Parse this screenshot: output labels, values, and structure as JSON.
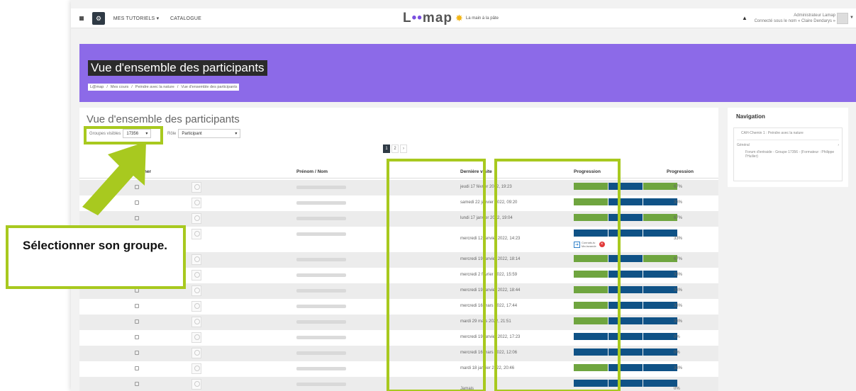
{
  "topbar": {
    "menu1": "MES TUTORIELS ▾",
    "menu2": "CATALOGUE",
    "logo": {
      "pre": "L",
      "accent": "••",
      "post": "map",
      "sub": "La main à la pâte"
    },
    "user_name": "Administrateur Lamap",
    "user_sub": "Connecté sous le nom « Claire Dendarys »"
  },
  "banner": {
    "title": "Vue d'ensemble des participants",
    "breadcrumb": [
      "L@map",
      "Mes cours",
      "Peindre avec la nature",
      "Vue d'ensemble des participants"
    ]
  },
  "main": {
    "title": "Vue d'ensemble des participants",
    "groups_label": "Groupes visibles",
    "groups_value": "17356",
    "role_label": "Rôle",
    "role_value": "Participant",
    "pages": [
      "1",
      "2",
      "›"
    ],
    "columns": {
      "select": "Sélectionner",
      "name": "Prénom / Nom",
      "last_visit": "Dernière visite",
      "progress_bar": "Progression",
      "progress_pct": "Progression"
    },
    "rows": [
      {
        "date": "jeudi 17 février 2022, 19:23",
        "pct": "67%",
        "bar": [
          "g",
          "b",
          "g"
        ]
      },
      {
        "date": "samedi 22 janvier 2022, 09:20",
        "pct": "33%",
        "bar": [
          "g",
          "b",
          "b"
        ]
      },
      {
        "date": "lundi 17 janvier 2022, 19:04",
        "pct": "67%",
        "bar": [
          "g",
          "b",
          "g"
        ]
      },
      {
        "date": "mercredi 12 janvier 2022, 14:23",
        "pct": "33%",
        "bar": [
          "b",
          "b",
          "b"
        ],
        "tall": true
      },
      {
        "date": "mercredi 19 janvier 2022, 18:14",
        "pct": "67%",
        "bar": [
          "g",
          "b",
          "g"
        ]
      },
      {
        "date": "mercredi 2 février 2022, 15:59",
        "pct": "33%",
        "bar": [
          "g",
          "b",
          "b"
        ]
      },
      {
        "date": "mercredi 19 janvier 2022, 18:44",
        "pct": "33%",
        "bar": [
          "g",
          "b",
          "b"
        ]
      },
      {
        "date": "mercredi 16 mars 2022, 17:44",
        "pct": "33%",
        "bar": [
          "g",
          "b",
          "b"
        ]
      },
      {
        "date": "mardi 29 mars 2022, 21:51",
        "pct": "33%",
        "bar": [
          "g",
          "b",
          "b"
        ]
      },
      {
        "date": "mercredi 19 janvier 2022, 17:23",
        "pct": "0%",
        "bar": [
          "b",
          "b",
          "b"
        ]
      },
      {
        "date": "mercredi 16 mars 2022, 12:06",
        "pct": "0%",
        "bar": [
          "b",
          "b",
          "b"
        ]
      },
      {
        "date": "mardi 18 janvier 2022, 20:46",
        "pct": "33%",
        "bar": [
          "g",
          "b",
          "b"
        ]
      },
      {
        "date": "Jamais",
        "pct": "0%",
        "bar": [
          "b",
          "b",
          "b"
        ],
        "tall": true
      }
    ]
  },
  "nav": {
    "title": "Navigation",
    "course": "CAH-Chemin 1 : Peindre avec la nature",
    "section": "Général",
    "forum": "Forum d'entraide - Groupe 17356 - (Formateur : Philippe l'Huilier)"
  },
  "activity": {
    "line1": "Connais-tu",
    "line2": "Ma lavande"
  },
  "callout": "Sélectionner son groupe.",
  "colors": {
    "accent": "#8c6ae8",
    "highlight": "#a8c91f",
    "done": "#6fa53f",
    "todo": "#0f5286"
  }
}
